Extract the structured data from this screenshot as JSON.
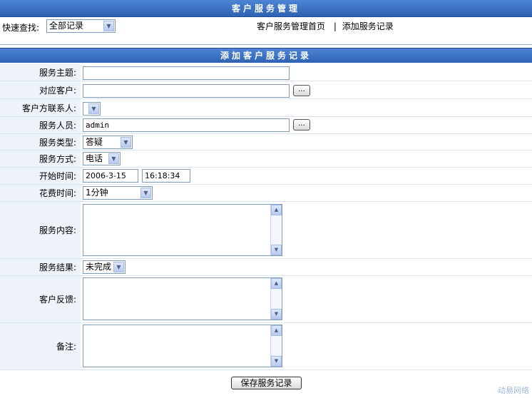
{
  "header": {
    "title": "客户服务管理"
  },
  "quick": {
    "label": "快速查找:",
    "select_value": "全部记录",
    "nav_home": "客户服务管理首页",
    "nav_sep": "|",
    "nav_add": "添加服务记录"
  },
  "form": {
    "title": "添加客户服务记录",
    "subject_label": "服务主题:",
    "subject_value": "",
    "customer_label": "对应客户:",
    "customer_value": "",
    "contact_label": "客户方联系人:",
    "contact_value": "",
    "staff_label": "服务人员:",
    "staff_value": "admin",
    "type_label": "服务类型:",
    "type_value": "答疑",
    "method_label": "服务方式:",
    "method_value": "电话",
    "start_label": "开始时间:",
    "start_date": "2006-3-15",
    "start_time": "16:18:34",
    "duration_label": "花费时间:",
    "duration_value": "1分钟",
    "content_label": "服务内容:",
    "result_label": "服务结果:",
    "result_value": "未完成",
    "feedback_label": "客户反馈:",
    "remark_label": "备注:",
    "browse_label": "...",
    "submit_label": "保存服务记录"
  },
  "watermark": "动易网络",
  "colors": {
    "header_bar": "#3a6fc0",
    "label_bg": "#eef3fa"
  }
}
